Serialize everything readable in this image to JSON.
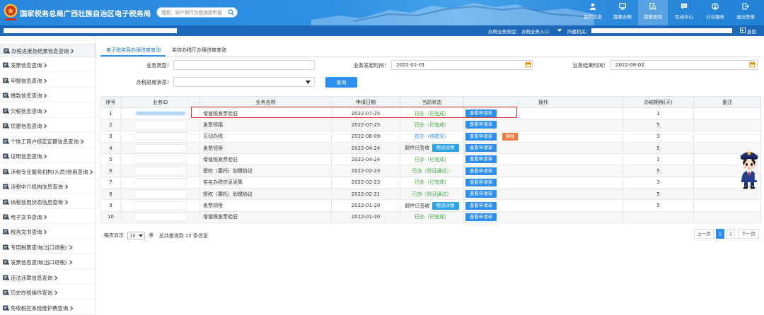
{
  "header": {
    "title": "国家税务总局广西壮族自治区电子税务局",
    "search_placeholder": "搜索：财产和行为税纳税申报",
    "nav": [
      {
        "label": "我的信息",
        "icon": "person-icon"
      },
      {
        "label": "我要办税",
        "icon": "monitor-icon"
      },
      {
        "label": "我要查询",
        "icon": "query-icon"
      },
      {
        "label": "互动中心",
        "icon": "chat-icon"
      },
      {
        "label": "公众服务",
        "icon": "public-service-icon"
      },
      {
        "label": "退出登录",
        "icon": "logout-icon"
      }
    ]
  },
  "subbar": {
    "business_type_label": "办税业务类型：",
    "business_type_value": "办税业务入口",
    "org_label": "所属机关：",
    "back_label": "返回"
  },
  "sidebar": {
    "items": [
      {
        "label": "办税进度及结果信息查询",
        "icon": "progress-icon"
      },
      {
        "label": "发票信息查询",
        "icon": "invoice-icon"
      },
      {
        "label": "申报信息查询",
        "icon": "declaration-icon"
      },
      {
        "label": "缴款信息查询",
        "icon": "payment-icon"
      },
      {
        "label": "欠税信息查询",
        "icon": "arrears-icon"
      },
      {
        "label": "优惠信息查询",
        "icon": "discount-icon"
      },
      {
        "label": "个体工商户核定定额信息查询",
        "icon": "business-icon"
      },
      {
        "label": "证明信息查询",
        "icon": "certificate-icon"
      },
      {
        "label": "涉税专业服务机构(人员)信用查询",
        "icon": "credit-icon"
      },
      {
        "label": "涉税中介机构信息查询",
        "icon": "agency-icon"
      },
      {
        "label": "纳税信用状态信息查询",
        "icon": "tax-credit-icon"
      },
      {
        "label": "电子文书查询",
        "icon": "e-document-icon"
      },
      {
        "label": "税务文书查询",
        "icon": "tax-document-icon"
      },
      {
        "label": "专用税票查询(出口退税)",
        "icon": "tax-ticket-icon"
      },
      {
        "label": "发票信息查询(出口退税)",
        "icon": "export-invoice-icon"
      },
      {
        "label": "违法违章信息查询",
        "icon": "violation-icon"
      },
      {
        "label": "历史办税操作查询",
        "icon": "history-icon"
      },
      {
        "label": "免收税控系统维护费查询",
        "icon": "maintenance-fee-icon"
      }
    ]
  },
  "tabs": [
    {
      "label": "电子税务局办理进度查询"
    },
    {
      "label": "实体办税厅办理进度查询"
    }
  ],
  "form": {
    "business_type": {
      "label": "业务类型：",
      "value": ""
    },
    "start_date": {
      "label": "业务发起时间：",
      "value": "2022-01-01"
    },
    "end_date": {
      "label": "业务结束时间：",
      "value": "2022-08-02"
    },
    "status": {
      "label": "办税进度状态：",
      "value": ""
    },
    "query_label": "查询"
  },
  "table": {
    "headers": [
      "序号",
      "业务ID",
      "业务名称",
      "申请日期",
      "当前状态",
      "操作",
      "办结期限(天)",
      "备注"
    ],
    "rows": [
      {
        "seq": "1",
        "name": "增值税发票验旧",
        "date": "2022-07-25",
        "status": "已办（已完成）",
        "status_color": "#37a836",
        "actions": [
          "查看申请单"
        ],
        "deadline": "1",
        "remark": ""
      },
      {
        "seq": "2",
        "name": "发票领用",
        "date": "2022-07-25",
        "status": "已办（已完成）",
        "status_color": "#37a836",
        "actions": [
          "查看申请单"
        ],
        "deadline": "5",
        "remark": ""
      },
      {
        "seq": "3",
        "name": "互动办税",
        "date": "2022-06-09",
        "status": "在办（待提交）",
        "status_color": "#2d8ff0",
        "actions": [
          "查看申请单",
          "删除"
        ],
        "deadline": "3",
        "remark": ""
      },
      {
        "seq": "4",
        "name": "发票领用",
        "date": "2022-04-24",
        "status": "邮件已签收",
        "status_color": "#333333",
        "status_button": "物流详情",
        "actions": [
          "查看申请单"
        ],
        "deadline": "5",
        "remark": ""
      },
      {
        "seq": "5",
        "name": "增值税发票验旧",
        "date": "2022-04-24",
        "status": "已办（已完成）",
        "status_color": "#37a836",
        "actions": [
          "查看申请单"
        ],
        "deadline": "1",
        "remark": ""
      },
      {
        "seq": "6",
        "name": "授权（委托）划缴协议",
        "date": "2022-02-23",
        "status": "已办（验证通过）",
        "status_color": "#37a836",
        "actions": [
          "查看申请单"
        ],
        "deadline": "5",
        "remark": ""
      },
      {
        "seq": "7",
        "name": "实名办税信息采集",
        "date": "2022-02-23",
        "status": "已办（已完成）",
        "status_color": "#37a836",
        "actions": [
          "查看申请单"
        ],
        "deadline": "3",
        "remark": ""
      },
      {
        "seq": "8",
        "name": "授权（委托）划缴协议",
        "date": "2022-02-21",
        "status": "已办（验证通过）",
        "status_color": "#37a836",
        "actions": [
          "查看申请单"
        ],
        "deadline": "5",
        "remark": ""
      },
      {
        "seq": "9",
        "name": "发票领用",
        "date": "2022-01-20",
        "status": "邮件已签收",
        "status_color": "#333333",
        "status_button": "物流详情",
        "actions": [
          "查看申请单"
        ],
        "deadline": "5",
        "remark": ""
      },
      {
        "seq": "10",
        "name": "增值税发票验旧",
        "date": "2022-01-20",
        "status": "已办（已完成）",
        "status_color": "#37a836",
        "actions": [
          "查看申请单"
        ],
        "deadline": "",
        "remark": ""
      }
    ]
  },
  "footer": {
    "page_size_prefix": "每页显示",
    "page_size": "10",
    "page_size_suffix": "条",
    "total_text": "总共查询到 12 条信息",
    "pagination": {
      "prev": "上一页",
      "pages": [
        "1",
        "2"
      ],
      "next": "下一页"
    }
  },
  "colors": {
    "header_blue": "#2a88dc",
    "subbar_blue": "#1c67b8",
    "button_blue": "#2d8ff0",
    "done_green": "#37a836",
    "delete_orange": "#f07b3f",
    "highlight_red": "#e53935"
  }
}
